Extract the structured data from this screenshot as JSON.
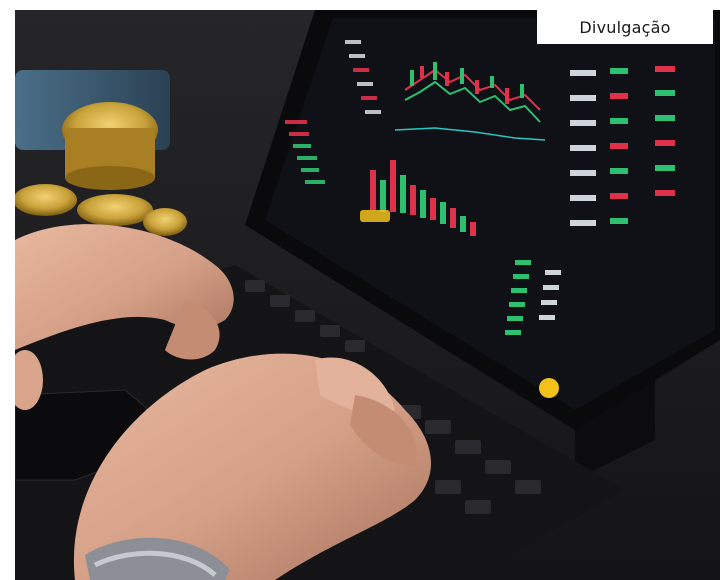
{
  "photo": {
    "credit_label": "Divulgação",
    "subject": "hands-typing-on-tablet-keyboard-with-crypto-trading-charts",
    "colors": {
      "background": "#1b1b1e",
      "bull_candle": "#2fbf71",
      "bear_candle": "#e0314b",
      "gold_coin": "#c9a23a",
      "skin": "#d49f86",
      "accent_yellow": "#f2c21b"
    }
  }
}
